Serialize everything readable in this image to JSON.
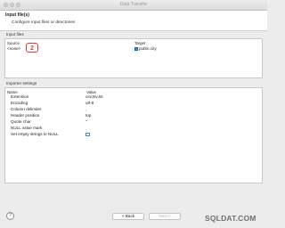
{
  "window": {
    "title": "Data Transfer"
  },
  "header": {
    "title": "Input file(s)",
    "subtitle": "Configure input files or directories"
  },
  "input_files": {
    "group_label": "Input files",
    "columns": {
      "source": "Source",
      "target": "Target"
    },
    "row": {
      "source": "<none>",
      "target": "public.city"
    },
    "badge": "2"
  },
  "importer_settings": {
    "group_label": "Importer settings",
    "columns": {
      "name": "Name",
      "value": "Value"
    },
    "rows": [
      {
        "name": "Extension",
        "value": "csv,tsv,txt"
      },
      {
        "name": "Encoding",
        "value": "utf-8"
      },
      {
        "name": "Column delimiter",
        "value": ","
      },
      {
        "name": "Header position",
        "value": "top"
      },
      {
        "name": "Quote char",
        "value": "\""
      },
      {
        "name": "NULL value mark",
        "value": ""
      },
      {
        "name": "Set empty strings to NULL",
        "value": ""
      }
    ]
  },
  "footer": {
    "help": "?",
    "back_label": "< Back",
    "next_label": "Next >",
    "watermark": "SQLDAT.COM"
  },
  "colors": {
    "badge": "#e23c2e",
    "accent": "#2f8fd8"
  }
}
